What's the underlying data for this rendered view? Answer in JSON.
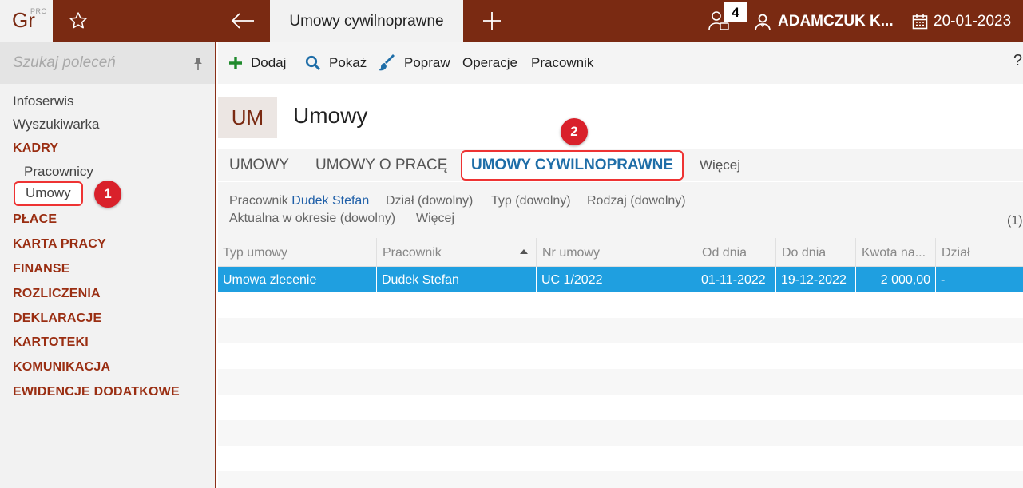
{
  "app": {
    "logo_text": "Gr",
    "logo_sup": "PRO",
    "active_tab": "Umowy cywilnoprawne",
    "notification_count": "4",
    "user_name": "ADAMCZUK K...",
    "date": "20-01-2023"
  },
  "sidebar": {
    "search_placeholder": "Szukaj poleceń",
    "items": [
      {
        "label": "Infoserwis"
      },
      {
        "label": "Wyszukiwarka"
      }
    ],
    "kadry": {
      "label": "KADRY",
      "sub": [
        {
          "label": "Pracownicy"
        },
        {
          "label": "Umowy"
        }
      ]
    },
    "categories": [
      {
        "label": "PŁACE"
      },
      {
        "label": "KARTA PRACY"
      },
      {
        "label": "FINANSE"
      },
      {
        "label": "ROZLICZENIA"
      },
      {
        "label": "DEKLARACJE"
      },
      {
        "label": "KARTOTEKI"
      },
      {
        "label": "KOMUNIKACJA"
      },
      {
        "label": "EWIDENCJE DODATKOWE"
      }
    ]
  },
  "markers": {
    "m1": "1",
    "m2": "2"
  },
  "toolbar": {
    "add": "Dodaj",
    "show": "Pokaż",
    "edit": "Popraw",
    "operations": "Operacje",
    "employee": "Pracownik",
    "help": "?"
  },
  "page": {
    "badge": "UM",
    "title": "Umowy"
  },
  "tabs": [
    {
      "label": "UMOWY"
    },
    {
      "label": "UMOWY O PRACĘ"
    },
    {
      "label": "UMOWY CYWILNOPRAWNE"
    },
    {
      "label": "Więcej"
    }
  ],
  "filters": {
    "employee_label": "Pracownik",
    "employee_value": "Dudek Stefan",
    "department": "Dział (dowolny)",
    "type": "Typ (dowolny)",
    "kind": "Rodzaj (dowolny)",
    "period": "Aktualna w okresie (dowolny)",
    "more": "Więcej",
    "count": "(1)"
  },
  "grid": {
    "columns": [
      "Typ umowy",
      "Pracownik",
      "Nr umowy",
      "Od dnia",
      "Do dnia",
      "Kwota na...",
      "Dział"
    ],
    "rows": [
      [
        "Umowa zlecenie",
        "Dudek Stefan",
        "UC 1/2022",
        "01-11-2022",
        "19-12-2022",
        "2 000,00",
        "-"
      ]
    ]
  },
  "colors": {
    "topbar": "#7a2a12",
    "category": "#9a2e12",
    "selected_row": "#1f9fe0",
    "marker": "#d9212b",
    "highlight_border": "#e33333",
    "active_tab_text": "#1f6ea8"
  }
}
